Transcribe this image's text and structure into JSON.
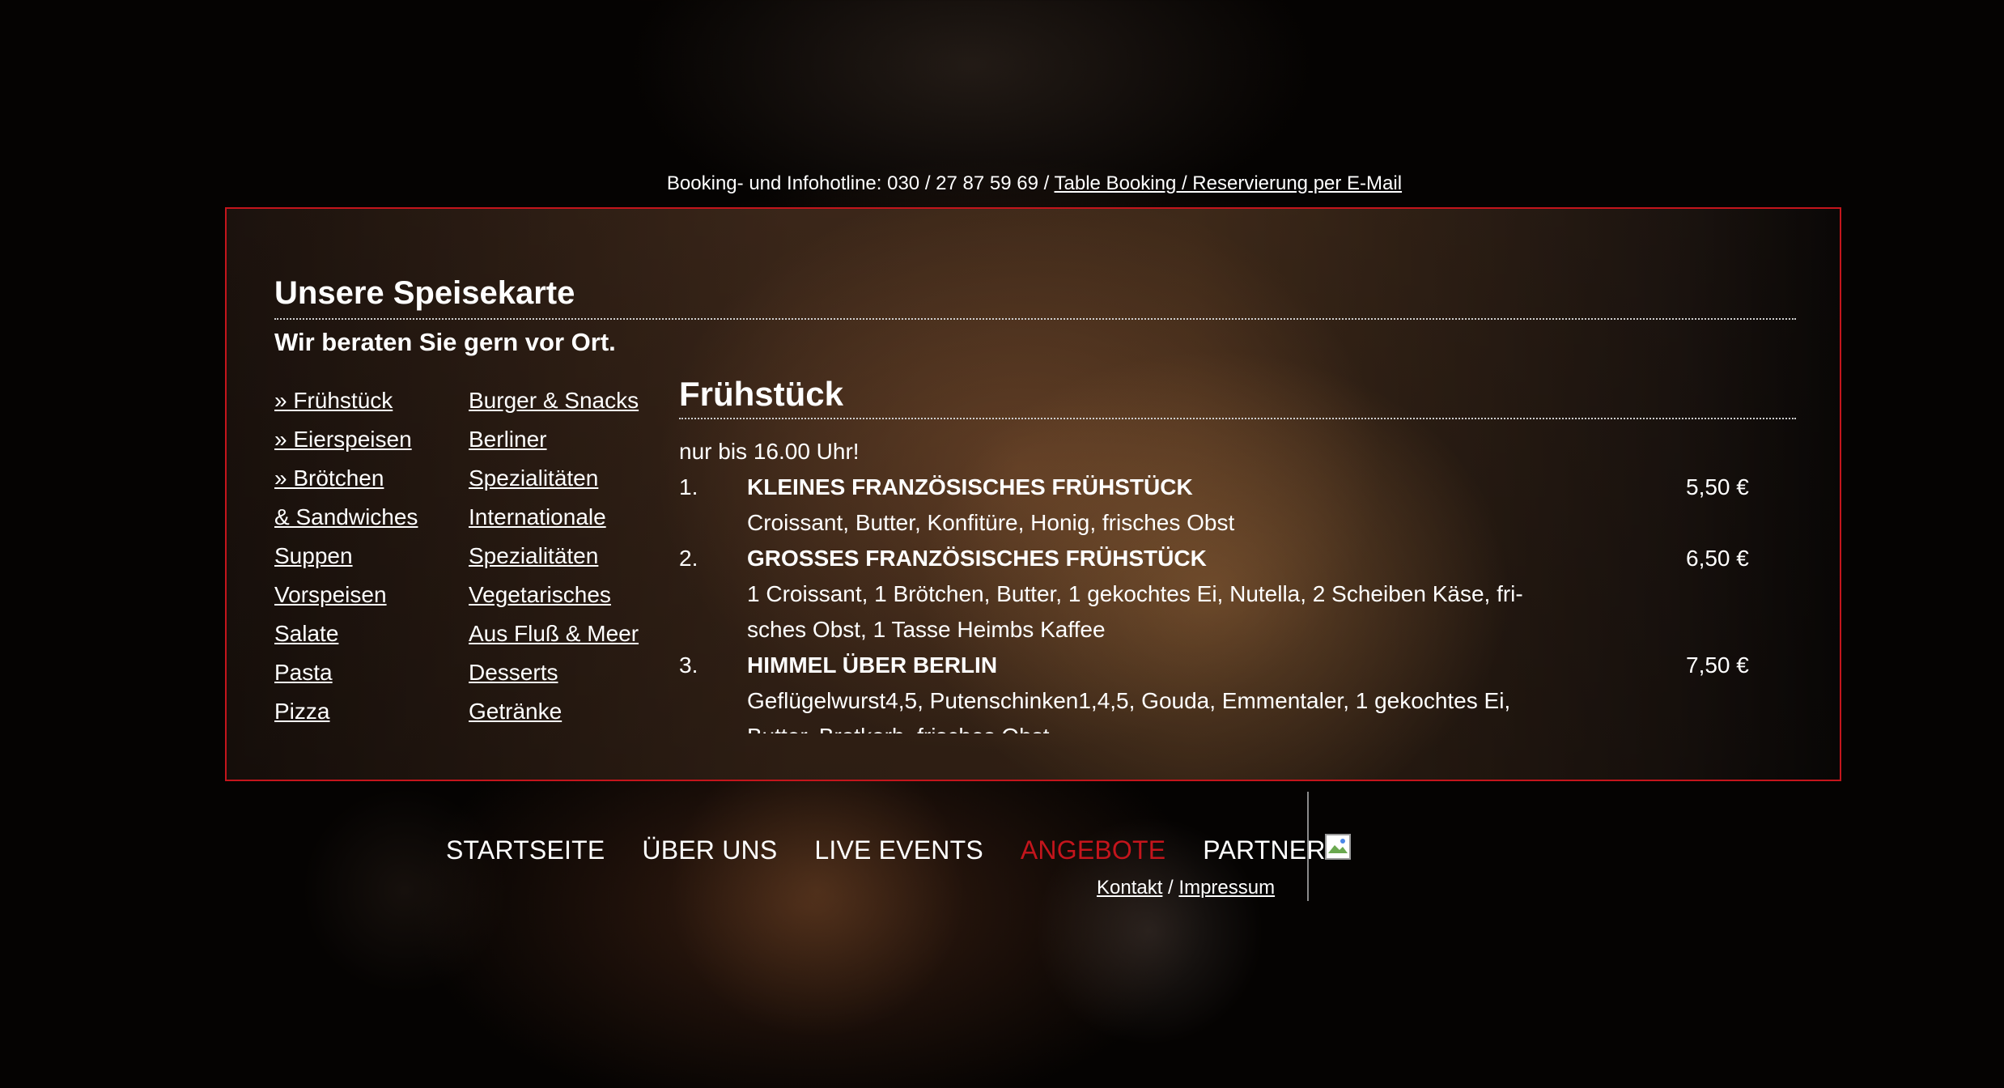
{
  "header": {
    "hotline_text": "Booking- und Infohotline: 030 / 27 87 59 69 / ",
    "booking_link": "Table Booking / Reservierung per E-Mail"
  },
  "menu": {
    "title": "Unsere Speisekarte",
    "subtitle": "Wir beraten Sie gern vor Ort.",
    "categories_col1": [
      "» Frühstück",
      "» Eierspeisen",
      "» Brötchen",
      "& Sandwiches",
      "Suppen",
      "Vorspeisen",
      "Salate",
      "Pasta",
      "Pizza"
    ],
    "categories_col2": [
      "Burger & Snacks",
      "Berliner",
      "Spezialitäten",
      "Internationale",
      "Spezialitäten",
      "Vegetarisches",
      "Aus Fluß & Meer",
      "Desserts",
      "Getränke"
    ],
    "section": {
      "title": "Frühstück",
      "note": "nur bis 16.00 Uhr!",
      "items": [
        {
          "num": "1.",
          "name": "KLEINES FRANZÖSISCHES FRÜHSTÜCK",
          "price": "5,50 €",
          "desc": "Croissant, Butter, Konfitüre, Honig, frisches Obst"
        },
        {
          "num": "2.",
          "name": "GROSSES FRANZÖSISCHES FRÜHSTÜCK",
          "price": "6,50 €",
          "desc": "1 Croissant, 1 Brötchen, Butter, 1 gekochtes Ei, Nutella, 2 Scheiben Käse, fri-sches Obst, 1 Tasse Heimbs Kaffee"
        },
        {
          "num": "3.",
          "name": "HIMMEL ÜBER BERLIN",
          "price": "7,50 €",
          "desc": "Geflügelwurst4,5, Putenschinken1,4,5, Gouda, Emmentaler, 1 gekochtes Ei, Butter, Brotkorb, frisches Obst"
        }
      ]
    }
  },
  "nav": {
    "items": [
      "STARTSEITE",
      "ÜBER UNS",
      "LIVE EVENTS",
      "ANGEBOTE",
      "PARTNER"
    ],
    "active": "ANGEBOTE",
    "active_color": "#c4151c",
    "kontakt": "Kontakt",
    "separator": " / ",
    "impressum": "Impressum"
  },
  "colors": {
    "frame_border": "#c4151c",
    "text": "#ffffff",
    "background": "#050302"
  }
}
